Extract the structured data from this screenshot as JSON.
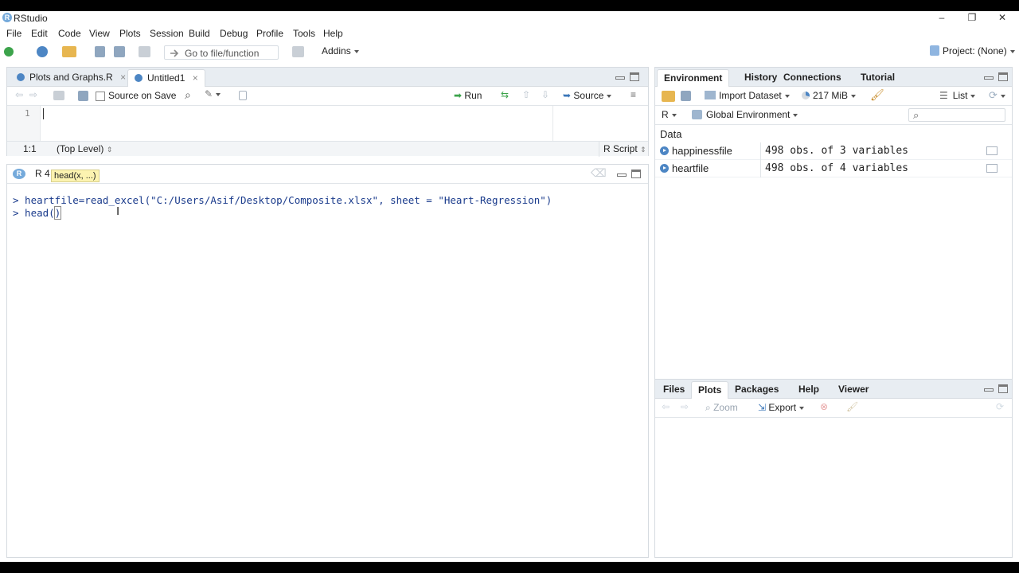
{
  "window": {
    "title": "RStudio",
    "minimize": "–",
    "restore": "❐",
    "close": "✕"
  },
  "menu": [
    "File",
    "Edit",
    "Code",
    "View",
    "Plots",
    "Session",
    "Build",
    "Debug",
    "Profile",
    "Tools",
    "Help"
  ],
  "toolbar": {
    "goto_placeholder": "Go to file/function",
    "addins": "Addins",
    "project": "Project: (None)"
  },
  "source": {
    "tabs": [
      "Plots and Graphs.R",
      "Untitled1"
    ],
    "source_on_save": "Source on Save",
    "run": "Run",
    "source": "Source",
    "line_number": "1",
    "status_pos": "1:1",
    "status_scope": "(Top Level)",
    "status_type": "R Script"
  },
  "console": {
    "title": "R 4",
    "tooltip": "head(x, ...)",
    "lines": [
      "> heartfile=read_excel(\"C:/Users/Asif/Desktop/Composite.xlsx\", sheet = \"Heart-Regression\")",
      "> head(",
      ")"
    ]
  },
  "env": {
    "tabs": [
      "Environment",
      "History",
      "Connections",
      "Tutorial"
    ],
    "import_dataset": "Import Dataset",
    "memory": "217 MiB",
    "list": "List",
    "lang": "R",
    "global_env": "Global Environment",
    "section": "Data",
    "rows": [
      {
        "name": "happinessfile",
        "value": "498 obs. of 3 variables"
      },
      {
        "name": "heartfile",
        "value": "498 obs. of 4 variables"
      }
    ]
  },
  "files": {
    "tabs": [
      "Files",
      "Plots",
      "Packages",
      "Help",
      "Viewer"
    ],
    "zoom": "Zoom",
    "export": "Export"
  },
  "colors": {
    "accent": "#75aadb",
    "pane_border": "#d6dbe0",
    "tab_bg": "#e8edf2",
    "code_blue": "#1a3b8c"
  }
}
